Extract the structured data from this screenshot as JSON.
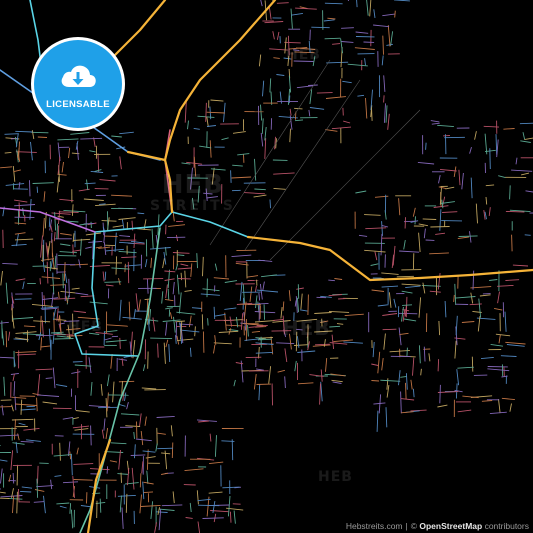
{
  "badge": {
    "label": "LICENSABLE",
    "icon": "cloud-download-icon",
    "color": "#1fa0e8"
  },
  "watermarks": {
    "big_title": "HEB",
    "big_sub": "STREITS",
    "small": "HEB"
  },
  "attribution": {
    "site": "Hebstreits.com",
    "separator": "|",
    "copyright": "©",
    "osm": "OpenStreetMap",
    "contributors": "contributors"
  },
  "map_style": {
    "background": "#000000",
    "major_road_color": "#f5b338",
    "secondary_road_color": "#5ad4e6",
    "minor_road_palette": [
      "#d8607a",
      "#5f9ee0",
      "#e0c070",
      "#9a78d8",
      "#68c3a8",
      "#e08850"
    ]
  }
}
